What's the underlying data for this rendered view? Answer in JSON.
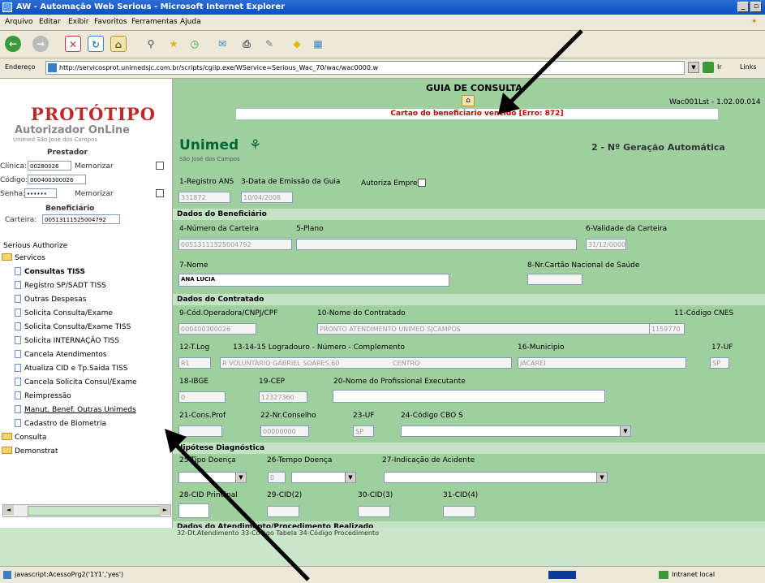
{
  "window": {
    "title": "AW - Automação Web Serious - Microsoft Internet Explorer",
    "menu": [
      "Arquivo",
      "Editar",
      "Exibir",
      "Favoritos",
      "Ferramentas",
      "Ajuda"
    ]
  },
  "address": {
    "label": "Endereço",
    "url": "http://servicosprot.unimedsjc.com.br/scripts/cgiip.exe/WService=Serious_Wac_70/wac/wac0000.w",
    "go_label": "Ir",
    "links_label": "Links"
  },
  "sidebar": {
    "logo_line1": "PROTÓTIPO",
    "logo_line2": "Autorizador OnLine",
    "logo_line3": "Unimed São José dos Campos",
    "prestador_title": "Prestador",
    "clinica_label": "Clínica:",
    "clinica_value": "00280026",
    "codigo_label": "Código:",
    "codigo_value": "000400300026",
    "senha_label": "Senha:",
    "senha_value": "••••••",
    "memorizar_label": "Memorizar",
    "beneficiario_title": "Beneficiário",
    "carteira_label": "Carteira:",
    "carteira_value": "00513111525004792",
    "tree_root": "Serious Authorize",
    "servicos": "Servicos",
    "items": [
      "Consultas TISS",
      "Registro SP/SADT TISS",
      "Outras Despesas",
      "Solicita Consulta/Exame",
      "Solicita Consulta/Exame TISS",
      "Solicita INTERNAÇÃO TISS",
      "Cancela Atendimentos",
      "Atualiza CID e Tp.Saida TISS",
      "Cancela Solicita Consul/Exame",
      "Reimpressão",
      "Manut. Benef. Outras Unimeds",
      "Cadastro de Biometria"
    ],
    "folders": [
      "Consulta",
      "Demonstrat"
    ]
  },
  "form": {
    "title": "GUIA DE CONSULTA",
    "version": "Wac001Lst - 1.02.00.014",
    "error_message": "Cartao do beneficiario vencido [Erro: 872]",
    "unimed_logo": "Unimed",
    "unimed_sub": "São José dos Campos",
    "geracao": "2 - Nº Geração Automática",
    "registro_ans_label": "1-Registro ANS",
    "registro_ans_value": "331872",
    "data_emissao_label": "3-Data de Emissão da Guia",
    "data_emissao_value": "10/04/2008",
    "autoriza_empresa_label": "Autoriza Empresa",
    "sec_beneficiario": "Dados do Beneficiário",
    "num_carteira_label": "4-Número da Carteira",
    "num_carteira_value": "00513111525004792",
    "plano_label": "5-Plano",
    "validade_label": "6-Validade da Carteira",
    "validade_value": "31/12/0000",
    "nome_label": "7-Nome",
    "nome_value": "ANA LUCIA",
    "cns_label": "8-Nr.Cartão Nacional de Saúde",
    "sec_contratado": "Dados do Contratado",
    "cod_operadora_label": "9-Cód.Operadora/CNPJ/CPF",
    "cod_operadora_value": "000400300026",
    "nome_contratado_label": "10-Nome do Contratado",
    "nome_contratado_value": "PRONTO ATENDIMENTO UNIMED SJCAMPOS",
    "cnes_label": "11-Código CNES",
    "cnes_value": "1159770",
    "tlog_label": "12-T.Log",
    "tlog_value": "R1",
    "logradouro_label": "13-14-15 Logradouro - Número - Complemento",
    "logradouro_value": "R VOLUNTARIO GABRIEL SOARES,60",
    "bairro_value": "CENTRO",
    "municipio_label": "16-Municipio",
    "municipio_value": "JACAREI",
    "uf_label": "17-UF",
    "uf_value": "SP",
    "ibge_label": "18-IBGE",
    "ibge_value": "0",
    "cep_label": "19-CEP",
    "cep_value": "12327360",
    "prof_exec_label": "20-Nome do Profissional Executante",
    "cons_prof_label": "21-Cons.Prof",
    "nr_conselho_label": "22-Nr.Conselho",
    "nr_conselho_value": "00000000",
    "uf23_label": "23-UF",
    "uf23_value": "SP",
    "cbo_label": "24-Código CBO S",
    "sec_hipotese": "Hipótese Diagnóstica",
    "tipo_doenca_label": "25-Tipo Doença",
    "tempo_doenca_label": "26-Tempo Doença",
    "tempo_doenca_value": "0",
    "acidente_label": "27-Indicação de Acidente",
    "cid_principal_label": "28-CID Principal",
    "cid2_label": "29-CID(2)",
    "cid3_label": "30-CID(3)",
    "cid4_label": "31-CID(4)",
    "sec_atendimento": "Dados do Atendimento/Procedimento Realizado",
    "atend_cols": "32-Dt.Atendimento   33-Código Tabela   34-Código Procedimento"
  },
  "status": {
    "text": "javascript:AcessoPrg2('1Y1','yes')",
    "zone": "Intranet local"
  }
}
